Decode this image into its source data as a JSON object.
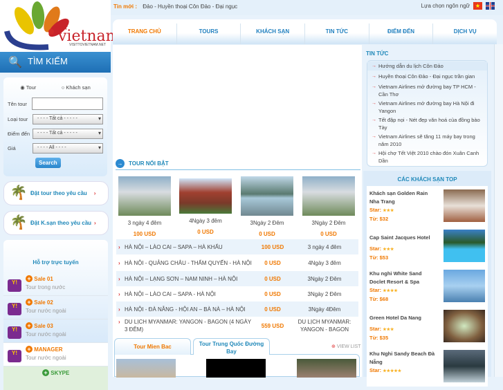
{
  "logo": {
    "text": "vietnam",
    "visit": "VISIT",
    "site": "VISITTOVIETNAM.NET"
  },
  "topbar": {
    "label": "Tin mới :",
    "news": "Đảo    - Huyền thoại Côn Đảo - Đại ngục",
    "lang_label": "Lựa chọn ngôn ngữ"
  },
  "nav": [
    "TRANG CHỦ",
    "TOURS",
    "KHÁCH SẠN",
    "TIN TỨC",
    "ĐIỂM ĐẾN",
    "DỊCH VỤ"
  ],
  "search": {
    "title": "TÌM KIẾM",
    "radio_tour": "Tour",
    "radio_hotel": "Khách sạn",
    "name_label": "Tên tour",
    "type_label": "Loại tour",
    "type_value": "- - - - Tất cả - - - - -",
    "dest_label": "Điểm đến",
    "dest_value": "- - - - Tất cả - - - - -",
    "price_label": "Giá",
    "price_value": "- - - - All - - - -",
    "button": "Search"
  },
  "banners": [
    "Đặt tour theo yêu cầu",
    "Đặt K.sạn theo yêu cầu"
  ],
  "support": {
    "title": "Hỗ trợ trực tuyến",
    "items": [
      {
        "name": "Sale 01",
        "desc": "Tour trong nước"
      },
      {
        "name": "Sale 02",
        "desc": "Tour nước ngoài"
      },
      {
        "name": "Sale 03",
        "desc": "Tour nước ngoài"
      },
      {
        "name": "MANAGER",
        "desc": "Tour nước ngoài"
      },
      {
        "name": "SKYPE",
        "desc": ""
      }
    ]
  },
  "featured": {
    "title": "TOUR NỔI BẬT",
    "items": [
      {
        "duration": "3 ngày 4 đêm",
        "price": "100 USD"
      },
      {
        "duration": "4Ngày 3 đêm",
        "price": "0 USD"
      },
      {
        "duration": "3Ngày 2 Đêm",
        "price": "0 USD"
      },
      {
        "duration": "3Ngày 2 Đêm",
        "price": "0 USD"
      }
    ]
  },
  "tours": [
    {
      "name": "HÀ NỘI – LÀO CAI – SAPA – HÀ KHẨU",
      "price": "100 USD",
      "duration": "3 ngày 4 đêm"
    },
    {
      "name": "HÀ NỘI - QUẢNG CHÂU - THẨM QUYẾN - HÀ NỘI",
      "price": "0 USD",
      "duration": "4Ngày 3 đêm"
    },
    {
      "name": "HÀ NỘI – LẠNG SƠN – NAM NINH – HÀ NỘI",
      "price": "0 USD",
      "duration": "3Ngày 2 Đêm"
    },
    {
      "name": "HÀ NỘI – LÀO CAI – SAPA - HÀ NỘI",
      "price": "0 USD",
      "duration": "3Ngày 2 Đêm"
    },
    {
      "name": "HÀ NỘI - ĐÀ NẴNG - HỘI AN – BÀ NÀ – HÀ NỘI",
      "price": "0 USD",
      "duration": "3Ngày 4Đêm"
    },
    {
      "name": "DU LỊCH MYANMAR: YANGON - BAGON (4 NGÀY 3 ĐÊM)",
      "price": "559 USD",
      "duration": "DU LỊCH MYANMAR: YANGON - BAGON"
    }
  ],
  "tabs": {
    "t1": "Tour Mien Bac",
    "t2": "Tour Trung Quốc Đường Bay",
    "view_list": "VIEW LIST"
  },
  "news": {
    "title": "TIN TỨC",
    "items": [
      "Hướng dẫn du lịch Côn Đảo",
      "Huyền thoại Côn Đảo - Đại ngục trần gian",
      "Vietnam Airlines mở đường bay TP HCM - Cần Thơ",
      "Vietnam Airlines mở đường bay Hà Nội đi Yangon",
      "Tết đập nọi - Nét đẹp văn hoá của đồng bào Tày",
      "Vietnam Airlines sẽ tăng 11 máy bay trong năm 2010",
      "Hội chợ Tết Việt 2010 chào đón Xuân Canh Dần"
    ]
  },
  "hotels": {
    "title": "CÁC KHÁCH SẠN TOP",
    "star_label": "Star:",
    "from_label": "Từ:",
    "items": [
      {
        "name": "Khách sạn Golden Rain Nha Trang",
        "stars": "★★★",
        "price": "$32",
        "rating": 3
      },
      {
        "name": "Cap Saint Jacques Hotel",
        "stars": "★★★",
        "price": "$53",
        "rating": 3
      },
      {
        "name": "Khu nghỉ White Sand Doclet Resort & Spa",
        "stars": "★★★★",
        "price": "$68",
        "rating": 4
      },
      {
        "name": "Green Hotel Da Nang",
        "stars": "★★★",
        "price": "$35",
        "rating": 3
      },
      {
        "name": "Khu Nghỉ Sandy Beach Đà Nẵng",
        "stars": "★★★★★",
        "price": "",
        "rating": 5
      }
    ]
  }
}
